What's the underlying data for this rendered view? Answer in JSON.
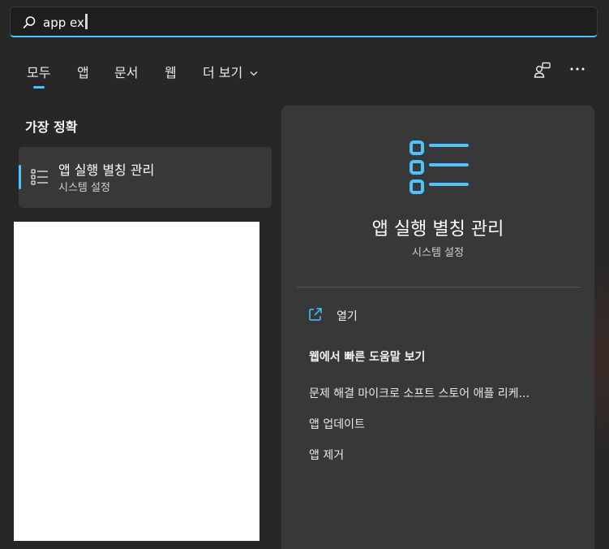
{
  "search": {
    "value": "app ex",
    "icon": "search-icon"
  },
  "tabs": [
    {
      "label": "모두",
      "active": true
    },
    {
      "label": "앱"
    },
    {
      "label": "문서"
    },
    {
      "label": "웹"
    },
    {
      "label": "더 보기"
    }
  ],
  "toolbar": {
    "share_icon": "share-people-icon",
    "more_icon": "more-dots-icon"
  },
  "best_match": {
    "heading": "가장 정확",
    "item": {
      "title": "앱 실행 별칭 관리",
      "subtitle": "시스템 설정",
      "icon": "list-settings-icon"
    }
  },
  "detail": {
    "title": "앱 실행 별칭 관리",
    "subtitle": "시스템 설정",
    "open_label": "열기",
    "web_heading": "웹에서 빠른 도움말 보기",
    "links": [
      "문제 해결 마이크로 소프트 스토어 애플 리케...",
      "앱 업데이트",
      "앱 제거"
    ]
  },
  "colors": {
    "accent": "#4cc2ff",
    "background": "#272727",
    "panel": "#3a3a3a"
  }
}
